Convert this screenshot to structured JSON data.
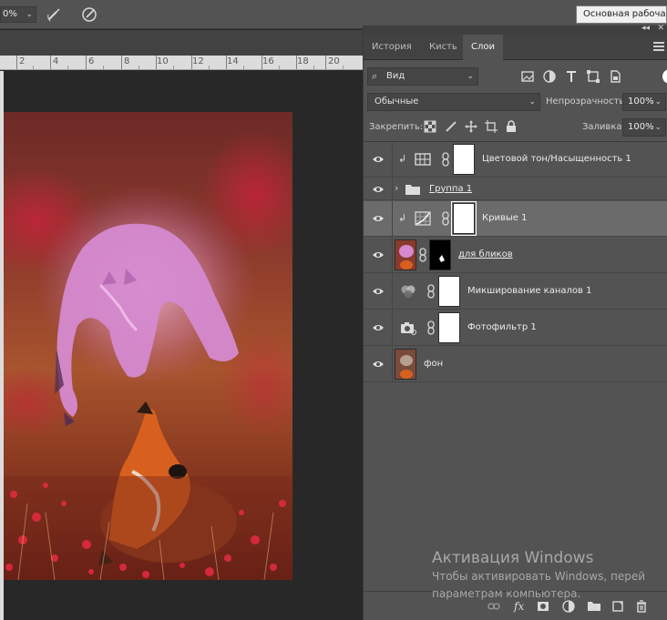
{
  "options_bar": {
    "zoom_value": "0%",
    "workspace": "Основная рабочая с"
  },
  "ruler": {
    "labels": [
      "2",
      "4",
      "6",
      "8",
      "10",
      "12",
      "14",
      "16",
      "18",
      "20"
    ]
  },
  "panel": {
    "tabs": [
      {
        "label": "История",
        "active": false
      },
      {
        "label": "Кисть",
        "active": false
      },
      {
        "label": "Слои",
        "active": true
      }
    ],
    "filter": {
      "value": "Вид"
    },
    "blend_mode": "Обычные",
    "opacity_label": "Непрозрачность:",
    "opacity_value": "100%",
    "lock_label": "Закрепить:",
    "fill_label": "Заливка:",
    "fill_value": "100%",
    "layers": [
      {
        "name": "Цветовой тон/Насыщенность 1",
        "kind": "hue-saturation",
        "visible": true,
        "clipped": true,
        "selected": false
      },
      {
        "name": "Группа 1",
        "kind": "group",
        "visible": true,
        "clipped": false,
        "selected": false
      },
      {
        "name": "Кривые 1",
        "kind": "curves",
        "visible": true,
        "clipped": true,
        "selected": true
      },
      {
        "name": "для бликов",
        "kind": "pixel-with-mask",
        "visible": true,
        "clipped": false,
        "selected": false
      },
      {
        "name": "Микширование каналов 1",
        "kind": "channel-mixer",
        "visible": true,
        "clipped": false,
        "selected": false
      },
      {
        "name": "Фотофильтр 1",
        "kind": "photo-filter",
        "visible": true,
        "clipped": false,
        "selected": false
      },
      {
        "name": "фон",
        "kind": "background",
        "visible": true,
        "clipped": false,
        "selected": false
      }
    ],
    "bottom_icons": [
      "link-icon",
      "fx-icon",
      "add-mask-icon",
      "adjustment-icon",
      "new-group-icon",
      "new-layer-icon",
      "trash-icon"
    ]
  },
  "watermark": {
    "title": "Активация Windows",
    "line1": "Чтобы активировать Windows, перей",
    "line2": "параметрам компьютера."
  },
  "colors": {
    "panel_bg": "#535353",
    "selected_layer": "#6b6b6b",
    "canvas_bg": "#282828"
  }
}
